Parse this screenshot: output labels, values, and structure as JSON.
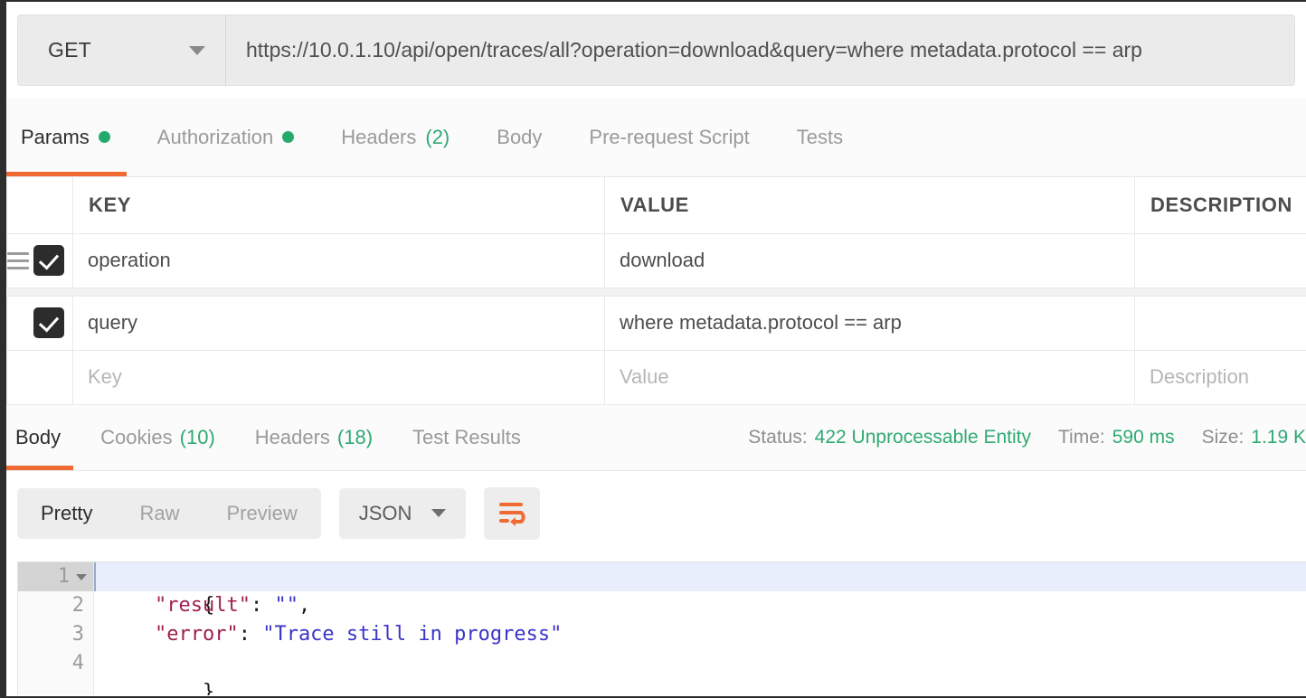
{
  "request": {
    "method": "GET",
    "url": "https://10.0.1.10/api/open/traces/all?operation=download&query=where metadata.protocol == arp",
    "tabs": [
      {
        "label": "Params",
        "badge_dot": true,
        "active": true
      },
      {
        "label": "Authorization",
        "badge_dot": true,
        "active": false
      },
      {
        "label": "Headers",
        "count": "(2)",
        "active": false
      },
      {
        "label": "Body",
        "active": false
      },
      {
        "label": "Pre-request Script",
        "active": false
      },
      {
        "label": "Tests",
        "active": false
      }
    ]
  },
  "params_table": {
    "headers": [
      "KEY",
      "VALUE",
      "DESCRIPTION"
    ],
    "rows": [
      {
        "checked": true,
        "key": "operation",
        "value": "download",
        "description": ""
      },
      {
        "checked": true,
        "key": "query",
        "value": "where metadata.protocol == arp",
        "description": ""
      }
    ],
    "placeholder_row": {
      "key": "Key",
      "value": "Value",
      "description": "Description"
    }
  },
  "response": {
    "tabs": [
      {
        "label": "Body",
        "active": true
      },
      {
        "label": "Cookies",
        "count": "(10)",
        "active": false
      },
      {
        "label": "Headers",
        "count": "(18)",
        "active": false
      },
      {
        "label": "Test Results",
        "active": false
      }
    ],
    "meta": {
      "status_label": "Status:",
      "status_value": "422 Unprocessable Entity",
      "time_label": "Time:",
      "time_value": "590 ms",
      "size_label": "Size:",
      "size_value": "1.19 K"
    },
    "format_bar": {
      "views": [
        {
          "label": "Pretty",
          "active": true
        },
        {
          "label": "Raw",
          "active": false
        },
        {
          "label": "Preview",
          "active": false
        }
      ],
      "language": "JSON",
      "wrap_icon": "word-wrap-icon"
    },
    "body_lines": [
      {
        "num": "1",
        "segments": [
          {
            "t": "{",
            "c": "k-punct"
          }
        ]
      },
      {
        "num": "2",
        "segments": [
          {
            "t": "    ",
            "c": "k-punct"
          },
          {
            "t": "\"result\"",
            "c": "k-key"
          },
          {
            "t": ": ",
            "c": "k-punct"
          },
          {
            "t": "\"\"",
            "c": "k-str"
          },
          {
            "t": ",",
            "c": "k-punct"
          }
        ]
      },
      {
        "num": "3",
        "segments": [
          {
            "t": "    ",
            "c": "k-punct"
          },
          {
            "t": "\"error\"",
            "c": "k-key"
          },
          {
            "t": ": ",
            "c": "k-punct"
          },
          {
            "t": "\"Trace still in progress\"",
            "c": "k-str"
          }
        ]
      },
      {
        "num": "4",
        "segments": [
          {
            "t": "}",
            "c": "k-punct"
          }
        ]
      }
    ]
  },
  "colors": {
    "accent_orange": "#ef6b33",
    "status_green": "#2eaa72",
    "dot_green": "#26a96c",
    "json_key": "#a02050",
    "json_string": "#3b35c9"
  }
}
